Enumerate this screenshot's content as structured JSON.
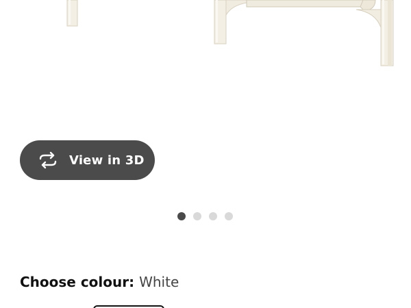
{
  "product_image": {
    "alt_icon": "furniture-image"
  },
  "view_3d": {
    "label": "View in 3D",
    "icon": "rotate-3d-icon"
  },
  "carousel": {
    "count": 4,
    "active_index": 0
  },
  "colour": {
    "heading": "Choose colour:",
    "selected": "White"
  },
  "colors": {
    "button_bg": "#4b4b4b",
    "dot_active": "#4a4a4a",
    "dot_inactive": "#d9d9d9",
    "furniture": "#f3efe4"
  }
}
